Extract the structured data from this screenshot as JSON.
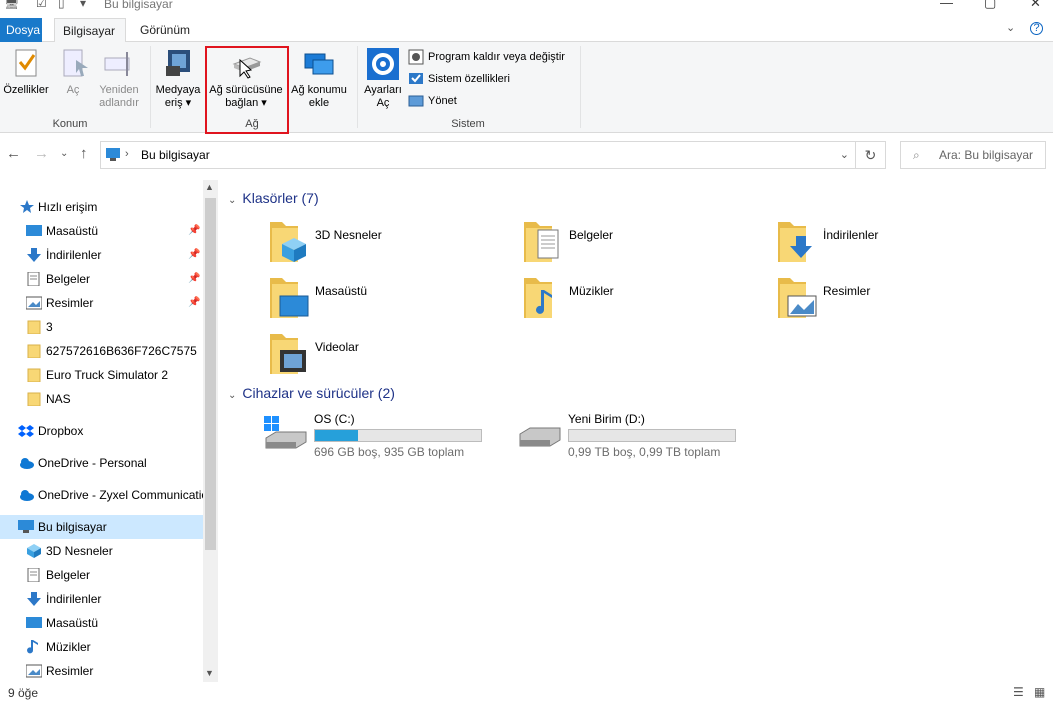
{
  "window": {
    "title": "Bu bilgisayar"
  },
  "tabs": [
    {
      "label": "Dosya"
    },
    {
      "label": "Bilgisayar"
    },
    {
      "label": "Görünüm"
    }
  ],
  "ribbon": {
    "konum": {
      "group_label": "Konum",
      "properties": "Özellikler",
      "open": "Aç",
      "rename_1": "Yeniden",
      "rename_2": "adlandır"
    },
    "ag": {
      "group_label": "Ağ",
      "media_1": "Medyaya",
      "media_2": "eriş",
      "map_drive_1": "Ağ sürücüsüne",
      "map_drive_2": "bağlan",
      "add_location_1": "Ağ konumu",
      "add_location_2": "ekle"
    },
    "sistem": {
      "group_label": "Sistem",
      "settings_1": "Ayarları",
      "settings_2": "Aç",
      "uninstall": "Program kaldır veya değiştir",
      "system_props": "Sistem özellikleri",
      "manage": "Yönet"
    }
  },
  "address": {
    "path": "Bu bilgisayar",
    "search_placeholder": "Ara: Bu bilgisayar"
  },
  "sidebar": {
    "quick_access": "Hızlı erişim",
    "quick_items": [
      "Masaüstü",
      "İndirilenler",
      "Belgeler",
      "Resimler",
      "3",
      "627572616B636F726C7575",
      "Euro Truck Simulator 2",
      "NAS"
    ],
    "dropbox": "Dropbox",
    "onedrive_personal": "OneDrive - Personal",
    "onedrive_zyxel": "OneDrive - Zyxel Communications",
    "this_pc": "Bu bilgisayar",
    "pc_items": [
      "3D Nesneler",
      "Belgeler",
      "İndirilenler",
      "Masaüstü",
      "Müzikler",
      "Resimler"
    ]
  },
  "content": {
    "folders_header": "Klasörler (7)",
    "folders": [
      "3D Nesneler",
      "Belgeler",
      "İndirilenler",
      "Masaüstü",
      "Müzikler",
      "Resimler",
      "Videolar"
    ],
    "devices_header": "Cihazlar ve sürücüler (2)",
    "drives": [
      {
        "name": "OS (C:)",
        "info": "696 GB boş, 935 GB toplam",
        "used_fraction": 0.26
      },
      {
        "name": "Yeni Birim (D:)",
        "info": "0,99 TB boş, 0,99 TB toplam",
        "used_fraction": 0.0
      }
    ]
  },
  "status": {
    "item_count": "9 öğe"
  },
  "colors": {
    "accent": "#1979ca",
    "selection": "#cce8ff",
    "highlight": "#e0141e",
    "drive_bar": "#26a0da"
  }
}
